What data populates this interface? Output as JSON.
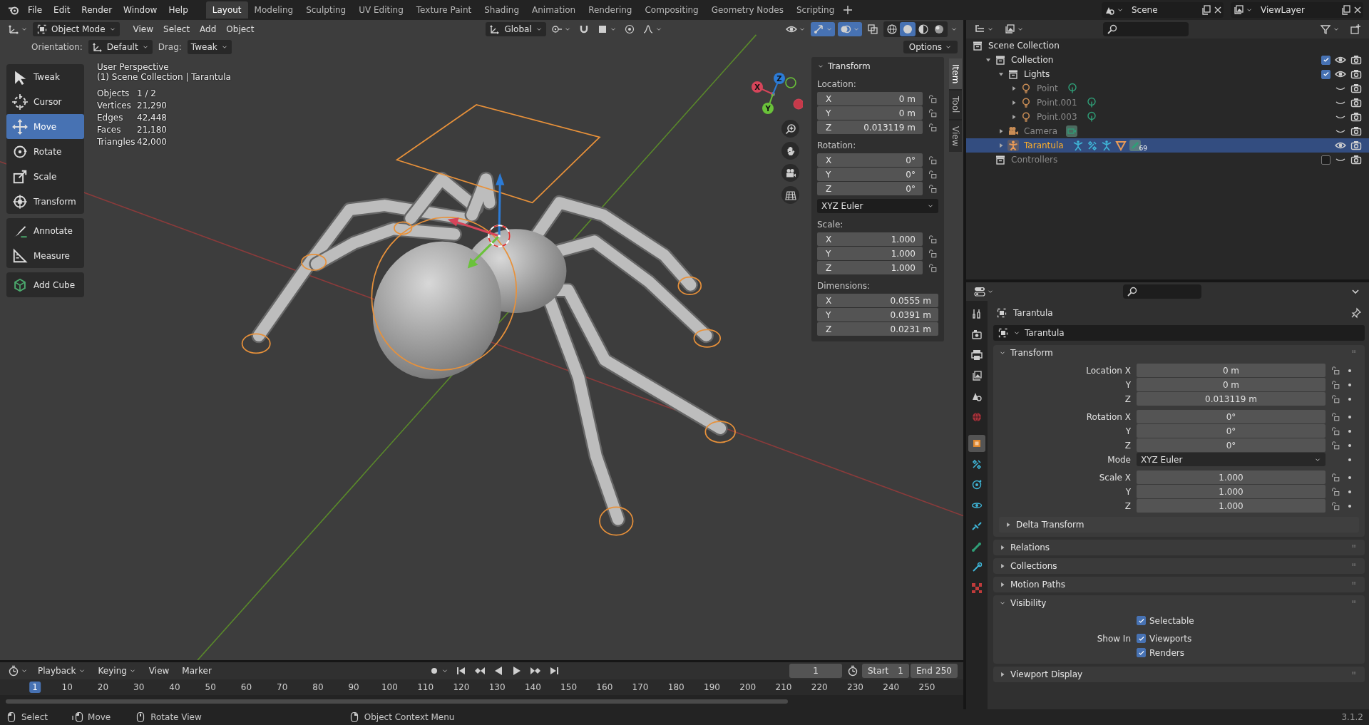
{
  "topbar": {
    "menus": [
      "File",
      "Edit",
      "Render",
      "Window",
      "Help"
    ],
    "workspaces": [
      {
        "label": "Layout",
        "selected": true
      },
      {
        "label": "Modeling",
        "selected": false
      },
      {
        "label": "Sculpting",
        "selected": false
      },
      {
        "label": "UV Editing",
        "selected": false
      },
      {
        "label": "Texture Paint",
        "selected": false
      },
      {
        "label": "Shading",
        "selected": false
      },
      {
        "label": "Animation",
        "selected": false
      },
      {
        "label": "Rendering",
        "selected": false
      },
      {
        "label": "Compositing",
        "selected": false
      },
      {
        "label": "Geometry Nodes",
        "selected": false
      },
      {
        "label": "Scripting",
        "selected": false
      }
    ],
    "scene": "Scene",
    "view_layer": "ViewLayer"
  },
  "viewport": {
    "mode": "Object Mode",
    "menus": [
      "View",
      "Select",
      "Add",
      "Object"
    ],
    "transform_orientation": "Global",
    "shading_modes": [
      {
        "kind": "wireframe",
        "selected": false
      },
      {
        "kind": "solid",
        "selected": true
      },
      {
        "kind": "material",
        "selected": false
      },
      {
        "kind": "rendered",
        "selected": false
      }
    ],
    "tool_settings": {
      "orientation_label": "Orientation:",
      "orientation": "Default",
      "drag_label": "Drag:",
      "drag": "Tweak",
      "options": "Options"
    },
    "tool_groups": [
      {
        "tools": [
          {
            "kind": "tweak",
            "label": "Tweak",
            "selected": false
          },
          {
            "kind": "cursor",
            "label": "Cursor",
            "selected": false
          },
          {
            "kind": "move",
            "label": "Move",
            "selected": true
          },
          {
            "kind": "rotate",
            "label": "Rotate",
            "selected": false
          },
          {
            "kind": "scale",
            "label": "Scale",
            "selected": false
          },
          {
            "kind": "transform",
            "label": "Transform",
            "selected": false
          }
        ]
      },
      {
        "tools": [
          {
            "kind": "annotate",
            "label": "Annotate",
            "selected": false
          },
          {
            "kind": "measure",
            "label": "Measure",
            "selected": false
          }
        ]
      },
      {
        "tools": [
          {
            "kind": "add_cube",
            "label": "Add Cube",
            "selected": false
          }
        ]
      }
    ],
    "view_name": "User Perspective",
    "context": "(1) Scene Collection | Tarantula",
    "stats": [
      {
        "label": "Objects",
        "value": "1 / 2"
      },
      {
        "label": "Vertices",
        "value": "21,290"
      },
      {
        "label": "Edges",
        "value": "42,448"
      },
      {
        "label": "Faces",
        "value": "21,180"
      },
      {
        "label": "Triangles",
        "value": "42,000"
      }
    ],
    "gizmo_axes": [
      "X",
      "Y",
      "Z"
    ],
    "sidebar_tabs": [
      {
        "label": "Item",
        "selected": true
      },
      {
        "label": "Tool",
        "selected": false
      },
      {
        "label": "View",
        "selected": false
      }
    ],
    "sidebar": {
      "title": "Transform",
      "groups": [
        {
          "label": "Location:",
          "fields": [
            {
              "axis": "X",
              "value": "0 m",
              "locked": false
            },
            {
              "axis": "Y",
              "value": "0 m",
              "locked": false
            },
            {
              "axis": "Z",
              "value": "0.013119 m",
              "locked": false
            }
          ]
        },
        {
          "label": "Rotation:",
          "fields": [
            {
              "axis": "X",
              "value": "0°",
              "locked": false
            },
            {
              "axis": "Y",
              "value": "0°",
              "locked": false
            },
            {
              "axis": "Z",
              "value": "0°",
              "locked": false
            }
          ],
          "mode": "XYZ Euler"
        },
        {
          "label": "Scale:",
          "fields": [
            {
              "axis": "X",
              "value": "1.000",
              "locked": false
            },
            {
              "axis": "Y",
              "value": "1.000",
              "locked": false
            },
            {
              "axis": "Z",
              "value": "1.000",
              "locked": false
            }
          ]
        },
        {
          "label": "Dimensions:",
          "fields": [
            {
              "axis": "X",
              "value": "0.0555 m"
            },
            {
              "axis": "Y",
              "value": "0.0391 m"
            },
            {
              "axis": "Z",
              "value": "0.0231 m"
            }
          ]
        }
      ]
    }
  },
  "outliner": {
    "tree": [
      {
        "name": "Scene Collection",
        "kind": "scene_collection",
        "selected": false,
        "children": [
          {
            "name": "Collection",
            "kind": "collection",
            "expanded": true,
            "enabled": true,
            "visible": true,
            "selected": false,
            "children": [
              {
                "name": "Lights",
                "kind": "collection",
                "expanded": true,
                "enabled": true,
                "visible": true,
                "selected": false,
                "children": [
                  {
                    "name": "Point",
                    "kind": "light",
                    "expanded": false,
                    "visible": false,
                    "selected": false
                  },
                  {
                    "name": "Point.001",
                    "kind": "light",
                    "expanded": false,
                    "visible": false,
                    "selected": false
                  },
                  {
                    "name": "Point.003",
                    "kind": "light",
                    "expanded": false,
                    "visible": false,
                    "selected": false
                  }
                ]
              },
              {
                "name": "Camera",
                "kind": "camera",
                "expanded": false,
                "visible": false,
                "selected": false
              },
              {
                "name": "Tarantula",
                "kind": "armature",
                "expanded": false,
                "visible": true,
                "selected": true,
                "badge": "69"
              }
            ]
          },
          {
            "name": "Controllers",
            "kind": "collection",
            "enabled": false,
            "visible": false,
            "selected": false
          }
        ]
      }
    ]
  },
  "properties": {
    "tabs": [
      {
        "kind": "tool",
        "selected": false
      },
      {
        "kind": "render",
        "selected": false
      },
      {
        "kind": "output",
        "selected": false
      },
      {
        "kind": "view_layer",
        "selected": false
      },
      {
        "kind": "scene",
        "selected": false
      },
      {
        "kind": "world",
        "selected": false
      },
      {
        "kind": "object",
        "selected": true
      },
      {
        "kind": "modifiers",
        "selected": false
      },
      {
        "kind": "particles",
        "selected": false
      },
      {
        "kind": "physics",
        "selected": false
      },
      {
        "kind": "constraints",
        "selected": false
      },
      {
        "kind": "data",
        "selected": false
      },
      {
        "kind": "bone_constraints",
        "selected": false
      },
      {
        "kind": "texture",
        "selected": false
      }
    ],
    "breadcrumb": "Tarantula",
    "object_name": "Tarantula",
    "panels": [
      {
        "title": "Transform",
        "expanded": true,
        "row_groups": [
          {
            "rows": [
              {
                "kind": "number",
                "label": "Location X",
                "value": "0 m",
                "locked": false
              },
              {
                "kind": "number",
                "label": "Y",
                "value": "0 m",
                "locked": false
              },
              {
                "kind": "number",
                "label": "Z",
                "value": "0.013119 m",
                "locked": false
              }
            ]
          },
          {
            "rows": [
              {
                "kind": "number",
                "label": "Rotation X",
                "value": "0°",
                "locked": false
              },
              {
                "kind": "number",
                "label": "Y",
                "value": "0°",
                "locked": false
              },
              {
                "kind": "number",
                "label": "Z",
                "value": "0°",
                "locked": false
              },
              {
                "kind": "dropdown",
                "label": "Mode",
                "value": "XYZ Euler"
              }
            ]
          },
          {
            "rows": [
              {
                "kind": "number",
                "label": "Scale X",
                "value": "1.000",
                "locked": false
              },
              {
                "kind": "number",
                "label": "Y",
                "value": "1.000",
                "locked": false
              },
              {
                "kind": "number",
                "label": "Z",
                "value": "1.000",
                "locked": false
              }
            ]
          }
        ],
        "subpanels": [
          {
            "title": "Delta Transform",
            "expanded": false
          }
        ]
      },
      {
        "title": "Relations",
        "expanded": false
      },
      {
        "title": "Collections",
        "expanded": false
      },
      {
        "title": "Motion Paths",
        "expanded": false
      },
      {
        "title": "Visibility",
        "expanded": true,
        "row_groups": [
          {
            "rows": [
              {
                "kind": "checkbox",
                "text": "Selectable",
                "checked": true
              }
            ]
          },
          {
            "rows": [
              {
                "kind": "checkbox",
                "label": "Show In",
                "text": "Viewports",
                "checked": true
              },
              {
                "kind": "checkbox",
                "text": "Renders",
                "checked": true
              }
            ]
          }
        ]
      },
      {
        "title": "Viewport Display",
        "expanded": false
      }
    ]
  },
  "timeline": {
    "menus": [
      {
        "label": "Playback",
        "kind": "dropdown"
      },
      {
        "label": "Keying",
        "kind": "dropdown"
      },
      {
        "label": "View",
        "kind": "menu"
      },
      {
        "label": "Marker",
        "kind": "menu"
      }
    ],
    "current_frame": "1",
    "start_label": "Start",
    "start": "1",
    "end_label": "End",
    "end": "250",
    "ruler": [
      {
        "label": "1",
        "selected": true
      },
      {
        "label": "10",
        "selected": false
      },
      {
        "label": "20",
        "selected": false
      },
      {
        "label": "30",
        "selected": false
      },
      {
        "label": "40",
        "selected": false
      },
      {
        "label": "50",
        "selected": false
      },
      {
        "label": "60",
        "selected": false
      },
      {
        "label": "70",
        "selected": false
      },
      {
        "label": "80",
        "selected": false
      },
      {
        "label": "90",
        "selected": false
      },
      {
        "label": "100",
        "selected": false
      },
      {
        "label": "110",
        "selected": false
      },
      {
        "label": "120",
        "selected": false
      },
      {
        "label": "130",
        "selected": false
      },
      {
        "label": "140",
        "selected": false
      },
      {
        "label": "150",
        "selected": false
      },
      {
        "label": "160",
        "selected": false
      },
      {
        "label": "170",
        "selected": false
      },
      {
        "label": "180",
        "selected": false
      },
      {
        "label": "190",
        "selected": false
      },
      {
        "label": "200",
        "selected": false
      },
      {
        "label": "210",
        "selected": false
      },
      {
        "label": "220",
        "selected": false
      },
      {
        "label": "230",
        "selected": false
      },
      {
        "label": "240",
        "selected": false
      },
      {
        "label": "250",
        "selected": false
      }
    ]
  },
  "status_bar": {
    "hints": [
      {
        "kind": "lmb",
        "label": "Select"
      },
      {
        "kind": "drag",
        "label": "Move"
      },
      {
        "kind": "mmb",
        "label": "Rotate View"
      },
      {
        "kind": "rmb",
        "label": "Object Context Menu"
      }
    ],
    "version": "3.1.2"
  }
}
